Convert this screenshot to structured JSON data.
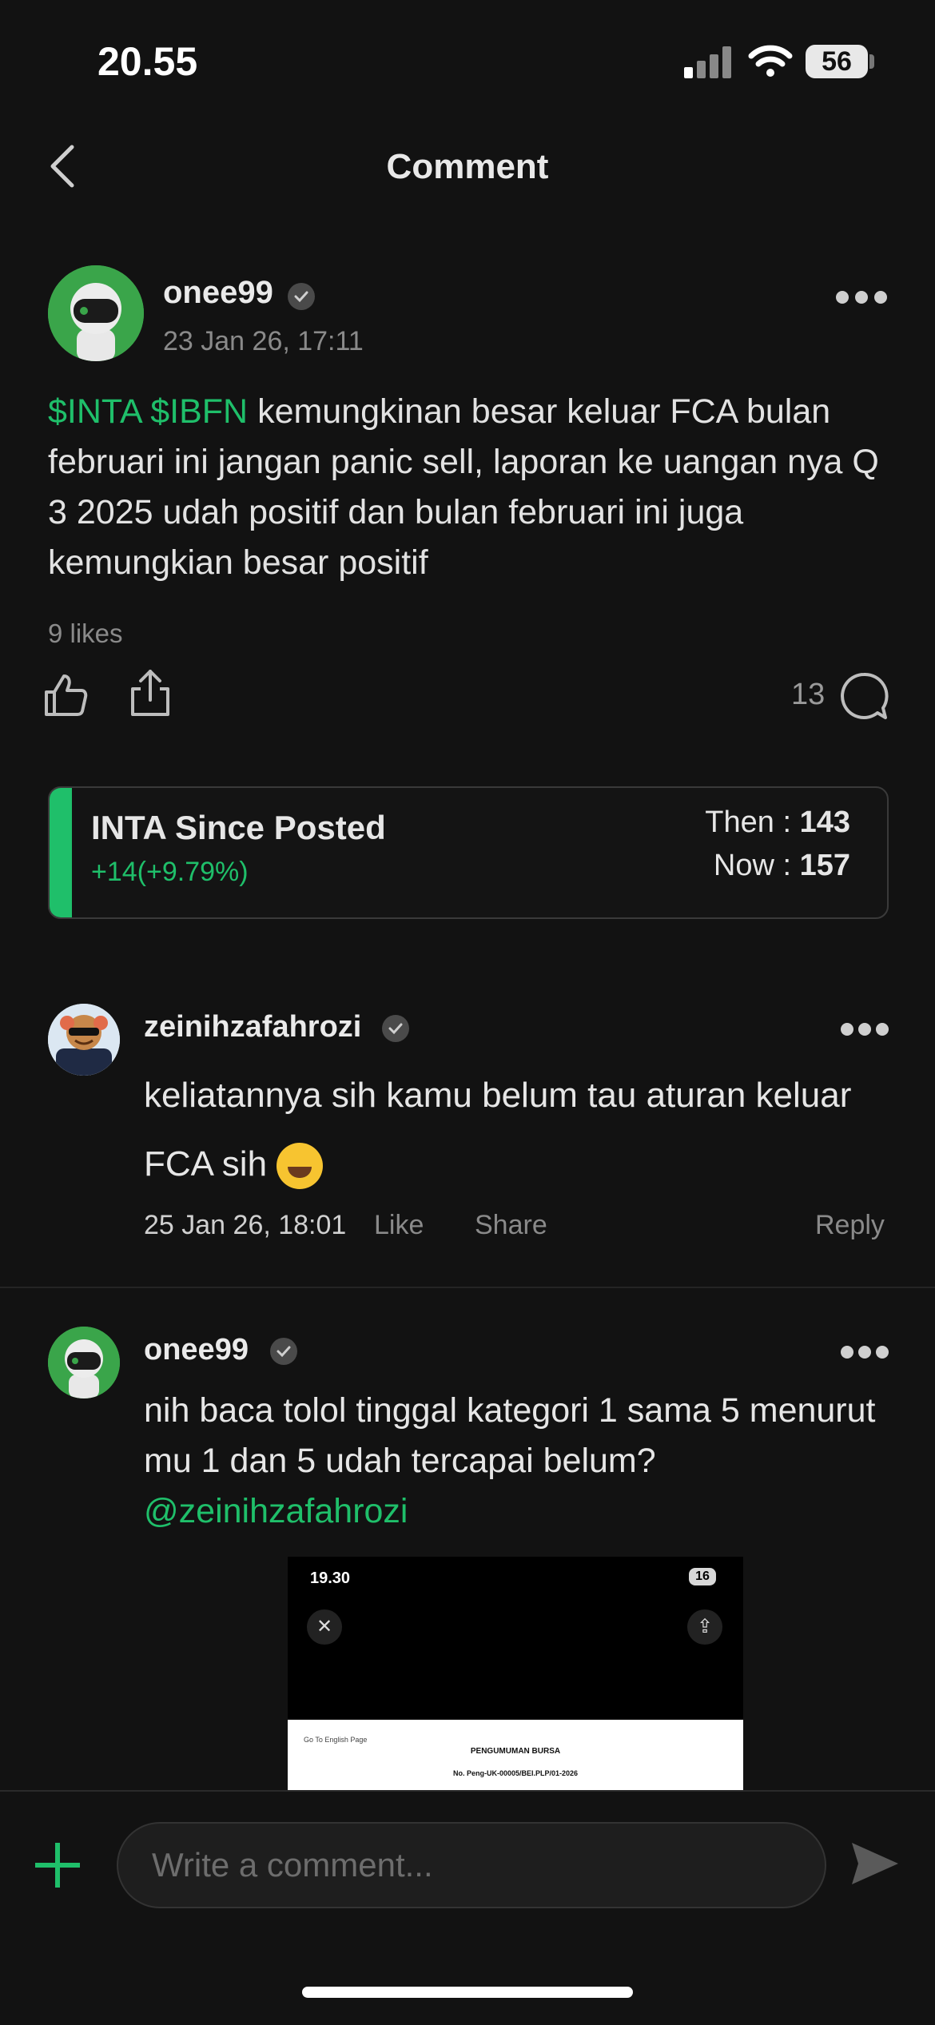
{
  "status_bar": {
    "time": "20.55",
    "battery": "56"
  },
  "header": {
    "title": "Comment"
  },
  "post": {
    "username": "onee99",
    "date": "23 Jan 26, 17:11",
    "tickers": "$INTA $IBFN",
    "body_line1": "kemungkinan besar keluar FCA",
    "body_rest": "bulan februari ini jangan panic sell, laporan ke uangan nya Q 3 2025 udah positif dan bulan februari ini juga kemungkian besar positif",
    "likes": "9 likes",
    "comment_count": "13"
  },
  "card": {
    "title": "INTA Since Posted",
    "change": "+14(+9.79%)",
    "then_label": "Then : ",
    "then_value": "143",
    "now_label": "Now : ",
    "now_value": "157",
    "accent": "#1fbf6a"
  },
  "comments": [
    {
      "username": "zeinihzafahrozi",
      "text": "keliatannya sih kamu belum tau aturan keluar FCA sih",
      "emoji": "rolling-on-floor-laughing",
      "date": "25 Jan 26, 18:01",
      "like_label": "Like",
      "share_label": "Share",
      "reply_label": "Reply"
    },
    {
      "username": "onee99",
      "text": "nih baca tolol tinggal kategori 1 sama 5 menurut mu 1 dan 5 udah tercapai belum?",
      "mention": "@zeinihzafahrozi",
      "attachment": {
        "time": "19.30",
        "battery": "16",
        "link": "Go To English Page",
        "heading": "PENGUMUMAN BURSA",
        "number": "No. Peng-UK-00005/BEI.PLP/01-2026"
      }
    }
  ],
  "composer": {
    "placeholder": "Write a comment..."
  },
  "colors": {
    "background": "#121212",
    "accent": "#1fbf6a"
  }
}
